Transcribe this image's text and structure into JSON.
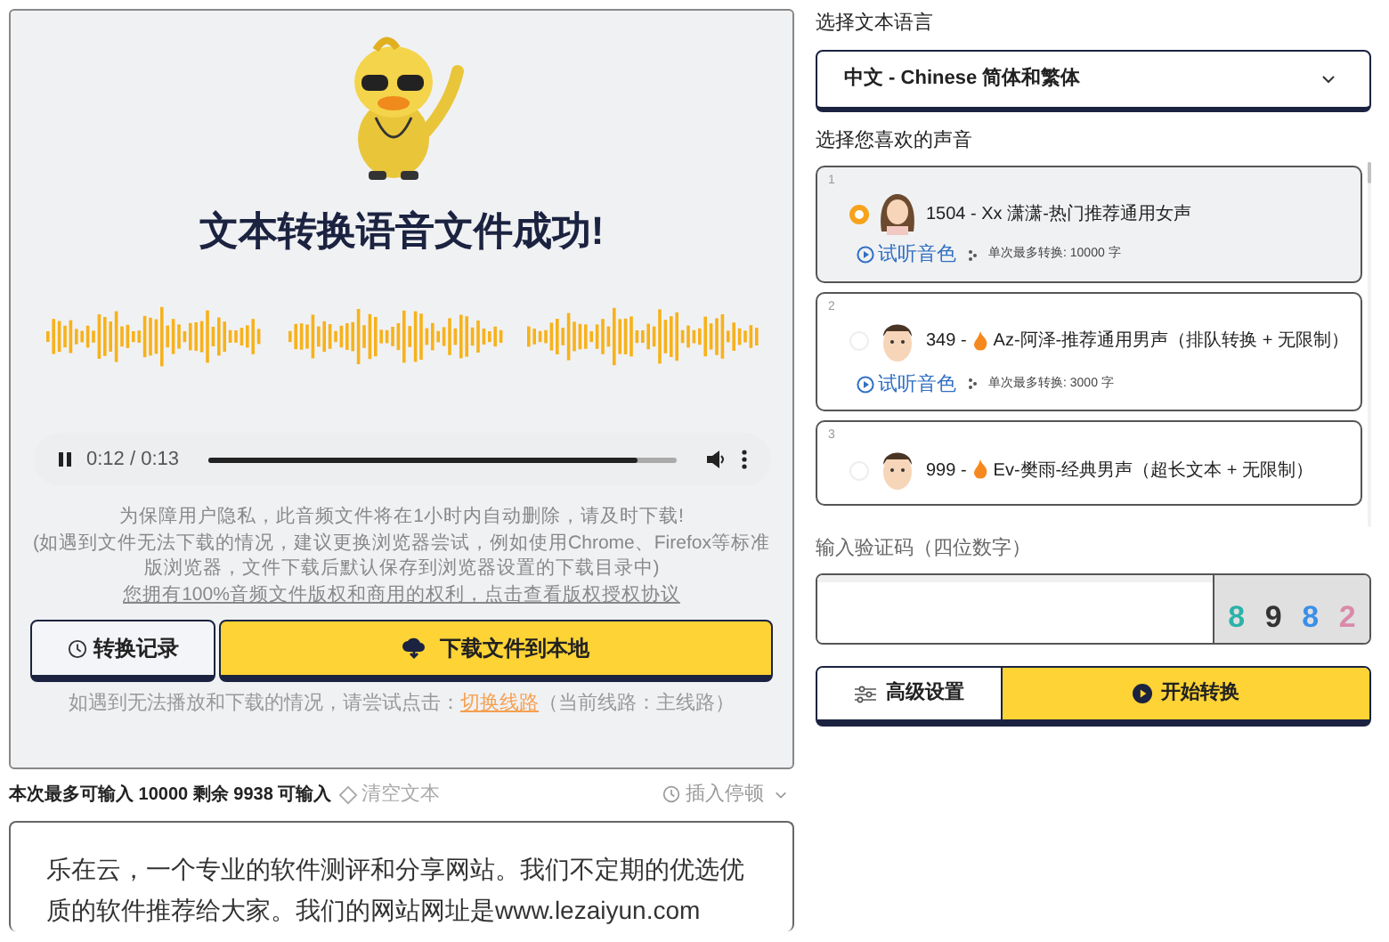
{
  "result": {
    "title": "文本转换语音文件成功!",
    "player": {
      "playing": true,
      "time": "0:12 / 0:13",
      "level": 0.92
    },
    "notes": [
      "为保障用户隐私，此音频文件将在1小时内自动删除，请及时下载!",
      "(如遇到文件无法下载的情况，建议更换浏览器尝试，例如使用Chrome、Firefox等标准版浏览器，文件下载后默认保存到浏览器设置的下载目录中)"
    ],
    "license_link": "您拥有100%音频文件版权和商用的权利，点击查看版权授权协议",
    "history_button": "转换记录",
    "download_button": "下载文件到本地",
    "fallback": {
      "text": "如遇到无法播放和下载的情况，请尝试点击：",
      "link": "切换线路",
      "current": "（当前线路：主线路）"
    }
  },
  "input": {
    "counter": "本次最多可输入 10000 剩余 9938 可输入",
    "clear": "清空文本",
    "pause": "插入停顿",
    "text": "乐在云，一个专业的软件测评和分享网站。我们不定期的优选优质的软件推荐给大家。我们的网站网址是www.lezaiyun.com"
  },
  "language": {
    "label": "选择文本语言",
    "value": "中文 - Chinese 简体和繁体"
  },
  "voices": {
    "label": "选择您喜欢的声音",
    "items": [
      {
        "index": "1",
        "name": "1504 - Xx 潇潇-热门推荐通用女声",
        "hot": false,
        "selected": true,
        "kind": "female",
        "preview": "试听音色",
        "limit": "单次最多转换: 10000 字"
      },
      {
        "index": "2",
        "name": "349 - Az-阿泽-推荐通用男声（排队转换 + 无限制）",
        "hot": true,
        "selected": false,
        "kind": "male",
        "preview": "试听音色",
        "limit": "单次最多转换: 3000 字"
      },
      {
        "index": "3",
        "name": "999 - Ev-樊雨-经典男声（超长文本 + 无限制）",
        "hot": true,
        "selected": false,
        "kind": "male"
      }
    ]
  },
  "captcha": {
    "label": "输入验证码（四位数字）",
    "chars": [
      {
        "char": "8",
        "color": "#2bb3a8"
      },
      {
        "char": "9",
        "color": "#333333"
      },
      {
        "char": "8",
        "color": "#3b8fe8"
      },
      {
        "char": "2",
        "color": "#d98aa8"
      }
    ]
  },
  "advanced_button": "高级设置",
  "start_button": "开始转换"
}
